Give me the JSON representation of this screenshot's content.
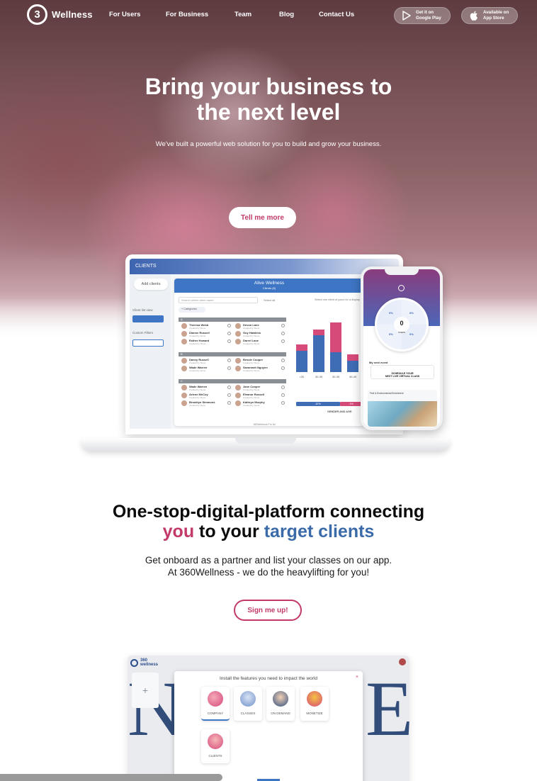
{
  "brand": {
    "name": "Wellness",
    "logo_digit": "3"
  },
  "nav": {
    "links": [
      "For Users",
      "For Business",
      "Team",
      "Blog",
      "Contact Us"
    ],
    "google_play": {
      "line1": "Get it on",
      "line2": "Google Play"
    },
    "app_store": {
      "line1": "Available on",
      "line2": "App Store"
    }
  },
  "hero": {
    "title_line1": "Bring your business to",
    "title_line2": "the next level",
    "subtitle": "We've built a powerful web solution for you to build and grow your business.",
    "cta": "Tell me more"
  },
  "laptop_app": {
    "header": "CLIENTS",
    "add_clients": "Add clients",
    "side_labels": [
      "Client list view",
      "Custom Filters"
    ],
    "panel_title": "Alive Wellness",
    "panel_subtitle": "Clients (8)",
    "search_placeholder": "Search within client name",
    "select_all": "Select all",
    "select_hint": "Select one client of yours for a display",
    "categories": "+ Categories",
    "groups": [
      "A",
      "B",
      "C"
    ],
    "clients": [
      "Theresa Webb",
      "Devon Lane",
      "Dianne Russell",
      "Guy Hawkins",
      "Esther Howard",
      "Darrel Lane",
      "Danny Russell",
      "Bessie Cooper",
      "Wade Warren",
      "Savannah Nguyen",
      "Wade Warren",
      "Jane Cooper",
      "Arlene McCoy",
      "Eleanor Russell",
      "Brooklyn Simmons",
      "Kathryn Murphy"
    ],
    "client_sub": "Created by Stone",
    "chart_ticks": [
      "<30",
      "30-39",
      "30-39",
      "40-49"
    ],
    "chart_legend": [
      "42%",
      "1%"
    ],
    "chart_footer": "GENDER AND AGE",
    "screen_caption": "360Wellness Pro ltd"
  },
  "phone_app": {
    "center_value": "0",
    "center_label": "STEPS",
    "wedge_values": [
      "0%",
      "0%",
      "0%",
      "0%"
    ],
    "next_event": "My next event",
    "card_line1": "SCHEDULE YOUR",
    "card_line2": "NEXT LIVE VIRTUAL CLASS",
    "feed_title": "Feel & Environmental Enrichment"
  },
  "section2": {
    "title_line1": "One-stop-digital-platform connecting",
    "title_you": "you",
    "title_mid": " to your ",
    "title_target": "target clients",
    "sub_line1": "Get onboard as a partner and list your classes on our app.",
    "sub_line2": "At 360Wellness - we do the heavylifting for you!",
    "cta": "Sign me up!"
  },
  "preview": {
    "logo_text": "360\nwellness",
    "plus": "+",
    "big_left": "N",
    "big_right": "E",
    "modal_title": "Install the features you need to impact the world",
    "close": "×",
    "features": [
      "COMPANY",
      "CLASSES",
      "ON DEMAND",
      "MONETIZE",
      "CLIENTS"
    ]
  },
  "colors": {
    "pink": "#c33a6a",
    "blue": "#3b6aa8",
    "app_blue": "#3e75c4"
  }
}
